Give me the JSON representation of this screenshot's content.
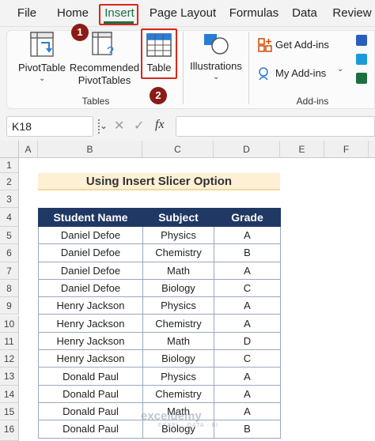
{
  "menu": {
    "tabs": [
      "File",
      "Home",
      "Insert",
      "Page Layout",
      "Formulas",
      "Data",
      "Review"
    ],
    "active_tab": "Insert"
  },
  "ribbon": {
    "tables_group": {
      "label": "Tables",
      "pivottable": "PivotTable",
      "recommended_line1": "Recommended",
      "recommended_line2": "PivotTables",
      "table": "Table"
    },
    "illustrations": "Illustrations",
    "addins_group": {
      "label": "Add-ins",
      "get_addins": "Get Add-ins",
      "my_addins": "My Add-ins"
    },
    "step_badges": [
      "1",
      "2"
    ]
  },
  "formula_bar": {
    "name_box": "K18",
    "fx_label": "fx",
    "formula": ""
  },
  "grid": {
    "columns": [
      "A",
      "B",
      "C",
      "D",
      "E",
      "F"
    ],
    "rows": [
      "1",
      "2",
      "3",
      "4",
      "5",
      "6",
      "7",
      "8",
      "9",
      "10",
      "11",
      "12",
      "13",
      "14",
      "15",
      "16"
    ]
  },
  "sheet": {
    "title": "Using Insert Slicer Option",
    "headers": [
      "Student Name",
      "Subject",
      "Grade"
    ],
    "rows": [
      [
        "Daniel Defoe",
        "Physics",
        "A"
      ],
      [
        "Daniel Defoe",
        "Chemistry",
        "B"
      ],
      [
        "Daniel Defoe",
        "Math",
        "A"
      ],
      [
        "Daniel Defoe",
        "Biology",
        "C"
      ],
      [
        "Henry Jackson",
        "Physics",
        "A"
      ],
      [
        "Henry Jackson",
        "Chemistry",
        "A"
      ],
      [
        "Henry Jackson",
        "Math",
        "D"
      ],
      [
        "Henry Jackson",
        "Biology",
        "C"
      ],
      [
        "Donald Paul",
        "Physics",
        "A"
      ],
      [
        "Donald Paul",
        "Chemistry",
        "A"
      ],
      [
        "Donald Paul",
        "Math",
        "A"
      ],
      [
        "Donald Paul",
        "Biology",
        "B"
      ]
    ]
  },
  "watermark": {
    "name": "exceldemy",
    "tagline": "EXCEL · DATA · BI"
  },
  "colors": {
    "header_bg": "#1f3864",
    "title_bg": "#fdf0d5",
    "highlight_red": "#d9261c",
    "badge": "#8b1b16",
    "excel_green": "#1d6f42"
  }
}
